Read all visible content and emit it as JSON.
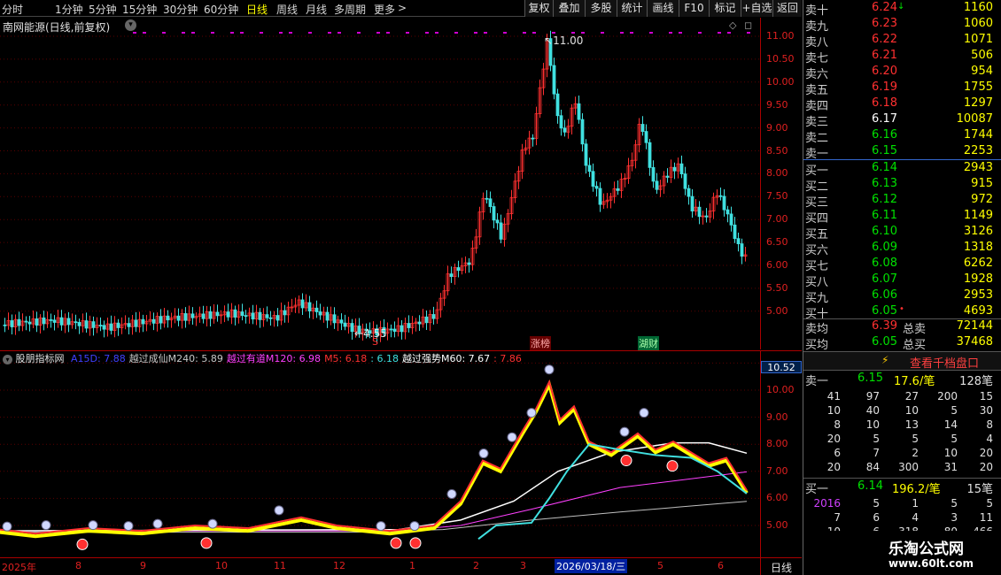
{
  "toolbar": {
    "periods": [
      "分时",
      "1分钟",
      "5分钟",
      "15分钟",
      "30分钟",
      "60分钟",
      "日线",
      "周线",
      "月线",
      "多周期",
      "更多"
    ],
    "selected": "日线",
    "more_arrow": ">",
    "buttons": [
      "复权",
      "叠加",
      "多股",
      "统计",
      "画线",
      "F10",
      "标记",
      "+自选",
      "返回"
    ]
  },
  "main": {
    "title": "南网能源(日线,前复权)",
    "high_label": "11.00",
    "low_label": "4.55",
    "markers": {
      "s": "S",
      "zhangbang": "涨榜",
      "lucai": "湖财"
    },
    "diamond": "◇",
    "corner_icon": "◻",
    "y_ticks": [
      "11.00",
      "10.50",
      "10.00",
      "9.50",
      "9.00",
      "8.50",
      "8.00",
      "7.50",
      "7.00",
      "6.50",
      "6.00",
      "5.50",
      "5.00"
    ],
    "y_values": [
      11.0,
      10.5,
      10.0,
      9.5,
      9.0,
      8.5,
      8.0,
      7.5,
      7.0,
      6.5,
      6.0,
      5.5,
      5.0
    ]
  },
  "indicator": {
    "name": "股朋指标网",
    "legend": [
      {
        "text": "A15D: 7.88",
        "color": "#4040ff"
      },
      {
        "text": "越过成仙M240: 5.89",
        "color": "#c8c8c8"
      },
      {
        "text": "越过有道M120: 6.98",
        "color": "#ff40ff"
      },
      {
        "text": "M5: 6.18",
        "color": "#ff3030"
      },
      {
        "text": ": 6.18",
        "color": "#40e0e0"
      },
      {
        "text": "越过强势M60: 7.67",
        "color": "#ffffff"
      },
      {
        "text": ": 7.86",
        "color": "#ff3030"
      }
    ],
    "current_value": "10.52",
    "y_ticks": [
      "11.00",
      "10.00",
      "9.00",
      "8.00",
      "7.00",
      "6.00",
      "5.00"
    ]
  },
  "xaxis": {
    "labels": [
      "2025年",
      "8",
      "9",
      "10",
      "11",
      "12",
      "1",
      "2",
      "3",
      "5",
      "6"
    ],
    "cursor_date": "2026/03/18/三",
    "period": "日线"
  },
  "orderbook": {
    "asks": [
      {
        "name": "卖十",
        "price": "6.24",
        "vol": "1160"
      },
      {
        "name": "卖九",
        "price": "6.23",
        "vol": "1060"
      },
      {
        "name": "卖八",
        "price": "6.22",
        "vol": "1071"
      },
      {
        "name": "卖七",
        "price": "6.21",
        "vol": "506"
      },
      {
        "name": "卖六",
        "price": "6.20",
        "vol": "954"
      },
      {
        "name": "卖五",
        "price": "6.19",
        "vol": "1755"
      },
      {
        "name": "卖四",
        "price": "6.18",
        "vol": "1297"
      },
      {
        "name": "卖三",
        "price": "6.17",
        "vol": "10087"
      },
      {
        "name": "卖二",
        "price": "6.16",
        "vol": "1744"
      },
      {
        "name": "卖一",
        "price": "6.15",
        "vol": "2253"
      }
    ],
    "bids": [
      {
        "name": "买一",
        "price": "6.14",
        "vol": "2943"
      },
      {
        "name": "买二",
        "price": "6.13",
        "vol": "915"
      },
      {
        "name": "买三",
        "price": "6.12",
        "vol": "972"
      },
      {
        "name": "买四",
        "price": "6.11",
        "vol": "1149"
      },
      {
        "name": "买五",
        "price": "6.10",
        "vol": "3126"
      },
      {
        "name": "买六",
        "price": "6.09",
        "vol": "1318"
      },
      {
        "name": "买七",
        "price": "6.08",
        "vol": "6262"
      },
      {
        "name": "买八",
        "price": "6.07",
        "vol": "1928"
      },
      {
        "name": "买九",
        "price": "6.06",
        "vol": "2953"
      },
      {
        "name": "买十",
        "price": "6.05",
        "vol": "4693"
      }
    ],
    "ask_avg": {
      "label": "卖均",
      "price": "6.39",
      "tlabel": "总卖",
      "total": "72144"
    },
    "bid_avg": {
      "label": "买均",
      "price": "6.05",
      "tlabel": "总买",
      "total": "37468"
    },
    "ask10_mark": "↓",
    "bid10_mark": "•"
  },
  "queue": {
    "button": "查看千档盘口",
    "ask_head": {
      "label": "卖一",
      "price": "6.15",
      "avg": "17.6/笔",
      "count": "128笔"
    },
    "ask_rows": [
      [
        "41",
        "97",
        "27",
        "200",
        "15"
      ],
      [
        "10",
        "40",
        "10",
        "5",
        "30"
      ],
      [
        "8",
        "10",
        "13",
        "14",
        "8"
      ],
      [
        "20",
        "5",
        "5",
        "5",
        "4"
      ],
      [
        "6",
        "7",
        "2",
        "10",
        "20"
      ],
      [
        "20",
        "84",
        "300",
        "31",
        "20"
      ]
    ],
    "bid_head": {
      "label": "买一",
      "price": "6.14",
      "avg": "196.2/笔",
      "count": "15笔"
    },
    "bid_rows": [
      [
        "2016",
        "5",
        "1",
        "5",
        "5"
      ],
      [
        "7",
        "6",
        "4",
        "3",
        "11"
      ],
      [
        "10",
        "6",
        "318",
        "80",
        "466"
      ]
    ]
  },
  "watermark": {
    "title": "乐淘公式网",
    "url": "www.60lt.com"
  },
  "colors": {
    "up": "#ff3030",
    "down": "#40e0e0",
    "ask": "#ff3030",
    "bid": "#00e000",
    "bg": "#000000",
    "volume": "#ffff00"
  }
}
